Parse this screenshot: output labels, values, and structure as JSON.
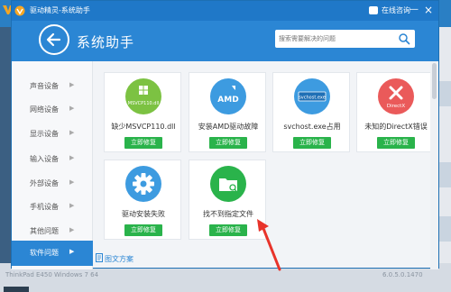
{
  "window": {
    "title": "驱动精灵-系统助手",
    "chat_label": "在线咨询",
    "minimize_label": "—",
    "close_label": "×"
  },
  "header": {
    "title": "系统助手",
    "search_placeholder": "搜索需要解决的问题"
  },
  "sidebar": {
    "items": [
      {
        "label": "声音设备",
        "active": false
      },
      {
        "label": "网络设备",
        "active": false
      },
      {
        "label": "显示设备",
        "active": false
      },
      {
        "label": "输入设备",
        "active": false
      },
      {
        "label": "外部设备",
        "active": false
      },
      {
        "label": "手机设备",
        "active": false
      },
      {
        "label": "其他问题",
        "active": false
      },
      {
        "label": "软件问题",
        "active": true
      }
    ]
  },
  "cards": [
    {
      "name": "缺少MSVCP110.dll",
      "button": "立即修复",
      "icon": "msvcp-dll-icon",
      "badge": "MSVCP110.dll",
      "color": "#7cc242"
    },
    {
      "name": "安装AMD驱动故障",
      "button": "立即修复",
      "icon": "amd-icon",
      "badge": "AMD",
      "color": "#3d9be0"
    },
    {
      "name": "svchost.exe占用",
      "button": "立即修复",
      "icon": "svchost-icon",
      "badge": "svchost.exe",
      "color": "#3d9be0"
    },
    {
      "name": "未知的DirectX错误",
      "button": "立即修复",
      "icon": "directx-icon",
      "badge": "DirectX",
      "color": "#ea5a5a"
    },
    {
      "name": "驱动安装失败",
      "button": "立即修复",
      "icon": "gear-icon",
      "badge": "",
      "color": "#3d9be0"
    },
    {
      "name": "找不到指定文件",
      "button": "立即修复",
      "icon": "folder-icon",
      "badge": "",
      "color": "#2ab34b"
    }
  ],
  "footer": {
    "doc_link": "图文方案"
  },
  "background": {
    "bottom_left": "ThinkPad E450  Windows 7 64",
    "bottom_right": "6.0.5.0.1470"
  },
  "colors": {
    "accent": "#2b86d4",
    "titlebar": "#1f78c8",
    "fix_button": "#2ab34b"
  }
}
